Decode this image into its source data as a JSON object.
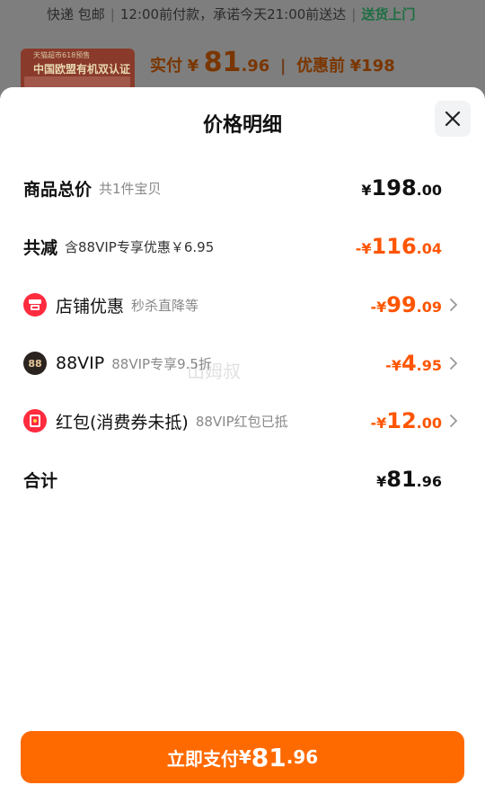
{
  "background": {
    "delivery": "快递 包邮",
    "promise": "12:00前付款，承诺今天21:00前送达",
    "home_delivery": "送货上门",
    "thumb_line1": "天猫超市618预售",
    "thumb_line2": "中国欧盟有机双认证",
    "actual_label": "实付",
    "currency": "¥",
    "actual_int": "81",
    "actual_dec": ".96",
    "original_label": "优惠前",
    "original_price": "¥198"
  },
  "sheet": {
    "title": "价格明细",
    "rows": [
      {
        "label": "商品总价",
        "sub": "共1件宝贝",
        "sign": "",
        "currency": "¥",
        "int": "198",
        "dec": ".00"
      },
      {
        "label": "共减",
        "sub": "含88VIP专享优惠￥6.95",
        "sign": "-",
        "currency": "¥",
        "int": "116",
        "dec": ".04"
      },
      {
        "label": "店铺优惠",
        "sub": "秒杀直降等",
        "sign": "-",
        "currency": "¥",
        "int": "99",
        "dec": ".09"
      },
      {
        "label": "88VIP",
        "sub": "88VIP专享9.5折",
        "sign": "-",
        "currency": "¥",
        "int": "4",
        "dec": ".95",
        "icon_text": "88"
      },
      {
        "label": "红包(消费券未抵)",
        "sub": "88VIP红包已抵",
        "sign": "-",
        "currency": "¥",
        "int": "12",
        "dec": ".00"
      },
      {
        "label": "合计",
        "sub": "",
        "sign": "",
        "currency": "¥",
        "int": "81",
        "dec": ".96"
      }
    ],
    "watermark": "山姆叔",
    "pay_button": {
      "label": "立即支付",
      "currency": "¥",
      "int": "81",
      "dec": ".96"
    }
  },
  "colors": {
    "accent": "#ff5500",
    "button": "#ff6a00",
    "icon_red": "#ff2b3f"
  },
  "icons": [
    "close-icon",
    "shop-icon",
    "vip-88-icon",
    "red-envelope-icon",
    "chevron-right-icon"
  ]
}
